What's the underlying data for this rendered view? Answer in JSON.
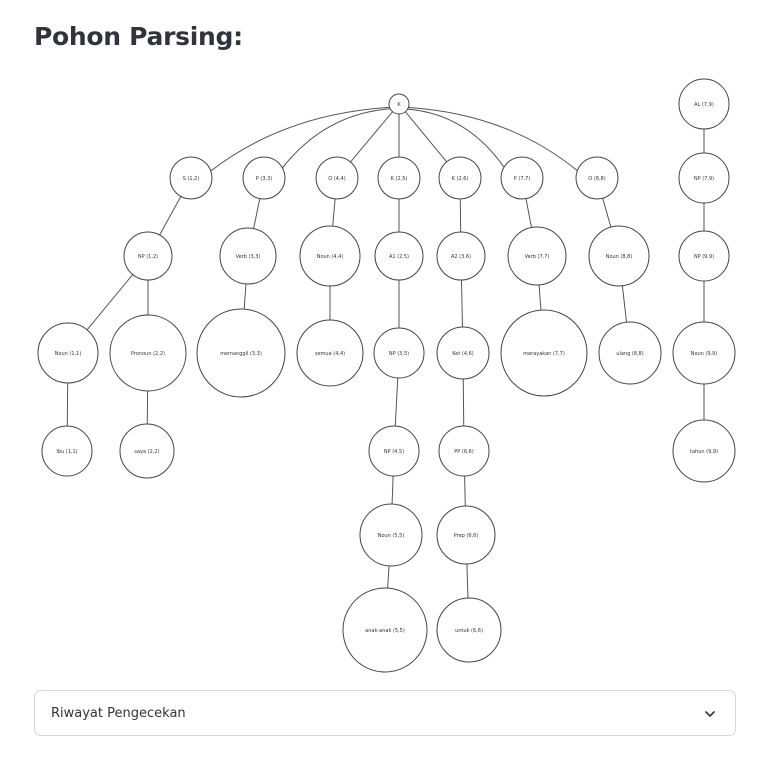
{
  "page": {
    "title": "Pohon Parsing:"
  },
  "tree": {
    "nodes": [
      {
        "id": "root",
        "label": "K"
      },
      {
        "id": "s12",
        "label": "S (1,2)"
      },
      {
        "id": "p33",
        "label": "P (3,3)"
      },
      {
        "id": "o44",
        "label": "O (4,4)"
      },
      {
        "id": "k25",
        "label": "K (2,5)"
      },
      {
        "id": "k26",
        "label": "K (2,6)"
      },
      {
        "id": "p77",
        "label": "P (7,7)"
      },
      {
        "id": "o88",
        "label": "O (8,8)"
      },
      {
        "id": "np12",
        "label": "NP (1,2)"
      },
      {
        "id": "verb33",
        "label": "Verb (3,3)"
      },
      {
        "id": "noun44",
        "label": "Noun (4,4)"
      },
      {
        "id": "a125",
        "label": "A1 (2,5)"
      },
      {
        "id": "a236",
        "label": "A2 (3,6)"
      },
      {
        "id": "verb77",
        "label": "Verb (7,7)"
      },
      {
        "id": "noun88",
        "label": "Noun (8,8)"
      },
      {
        "id": "noun11",
        "label": "Noun (1,1)"
      },
      {
        "id": "pronoun22",
        "label": "Pronoun (2,2)"
      },
      {
        "id": "memanggil33",
        "label": "memanggil (3,3)"
      },
      {
        "id": "semua44",
        "label": "semua (4,4)"
      },
      {
        "id": "np35",
        "label": "NP (3,5)"
      },
      {
        "id": "ket46",
        "label": "Ket (4,6)"
      },
      {
        "id": "merayakan77",
        "label": "merayakan (7,7)"
      },
      {
        "id": "ulang88",
        "label": "ulang (8,8)"
      },
      {
        "id": "ibu11",
        "label": "Ibu (1,1)"
      },
      {
        "id": "saya22",
        "label": "saya (2,2)"
      },
      {
        "id": "np45",
        "label": "NP (4,5)"
      },
      {
        "id": "pp66",
        "label": "PP (6,6)"
      },
      {
        "id": "noun55",
        "label": "Noun (5,5)"
      },
      {
        "id": "prep66",
        "label": "Prep (6,6)"
      },
      {
        "id": "anakanak55",
        "label": "anak-anak (5,5)"
      },
      {
        "id": "untuk66",
        "label": "untuk (6,6)"
      },
      {
        "id": "al79",
        "label": "AL (7,9)"
      },
      {
        "id": "np79",
        "label": "NP (7,9)"
      },
      {
        "id": "np99",
        "label": "NP (9,9)"
      },
      {
        "id": "noun99",
        "label": "Noun (9,9)"
      },
      {
        "id": "tahun99",
        "label": "tahun (9,9)"
      }
    ],
    "edges": [
      [
        "root",
        "s12"
      ],
      [
        "root",
        "p33"
      ],
      [
        "root",
        "o44"
      ],
      [
        "root",
        "k25"
      ],
      [
        "root",
        "k26"
      ],
      [
        "root",
        "p77"
      ],
      [
        "root",
        "o88"
      ],
      [
        "s12",
        "np12"
      ],
      [
        "np12",
        "noun11"
      ],
      [
        "np12",
        "pronoun22"
      ],
      [
        "noun11",
        "ibu11"
      ],
      [
        "pronoun22",
        "saya22"
      ],
      [
        "p33",
        "verb33"
      ],
      [
        "verb33",
        "memanggil33"
      ],
      [
        "o44",
        "noun44"
      ],
      [
        "noun44",
        "semua44"
      ],
      [
        "k25",
        "a125"
      ],
      [
        "a125",
        "np35"
      ],
      [
        "np35",
        "np45"
      ],
      [
        "np45",
        "noun55"
      ],
      [
        "noun55",
        "anakanak55"
      ],
      [
        "k26",
        "a236"
      ],
      [
        "a236",
        "ket46"
      ],
      [
        "ket46",
        "pp66"
      ],
      [
        "pp66",
        "prep66"
      ],
      [
        "prep66",
        "untuk66"
      ],
      [
        "p77",
        "verb77"
      ],
      [
        "verb77",
        "merayakan77"
      ],
      [
        "o88",
        "noun88"
      ],
      [
        "noun88",
        "ulang88"
      ],
      [
        "al79",
        "np79"
      ],
      [
        "np79",
        "np99"
      ],
      [
        "np99",
        "noun99"
      ],
      [
        "noun99",
        "tahun99"
      ]
    ]
  },
  "expander": {
    "label": "Riwayat Pengecekan",
    "icon": "chevron-down-icon"
  }
}
